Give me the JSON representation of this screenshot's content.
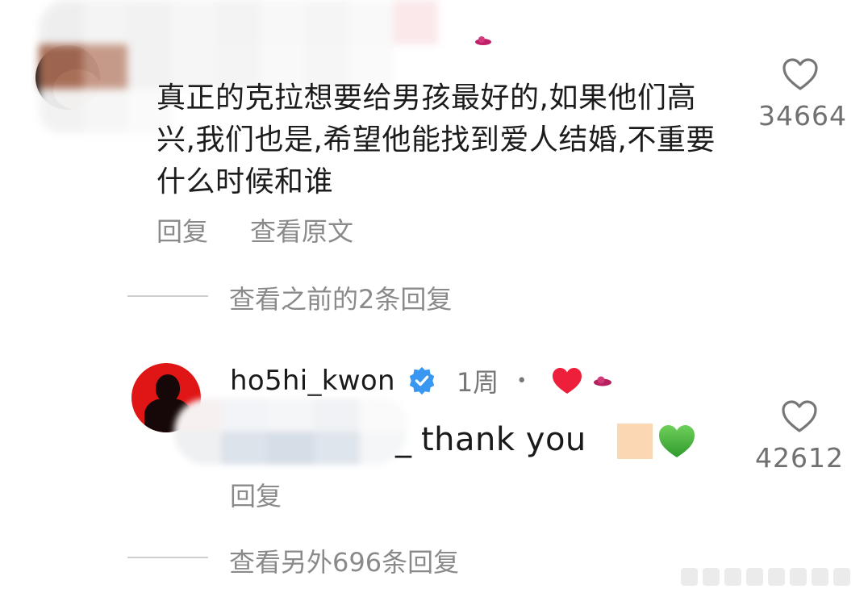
{
  "comment": {
    "text": "真正的克拉想要给男孩最好的,如果他们高兴,我们也是,希望他能找到爱人结婚,不重要什么时候和谁",
    "like_count": "34664",
    "actions": {
      "reply_label": "回复",
      "view_original_label": "查看原文"
    }
  },
  "view_previous_replies": "查看之前的2条回复",
  "reply": {
    "username": "ho5hi_kwon",
    "time": "1周",
    "separator": "•",
    "mention_suffix": "_",
    "text": "thank you",
    "like_count": "42612",
    "reply_label": "回复"
  },
  "view_more_replies": "查看另外696条回复",
  "colors": {
    "verified_badge": "#3897f0",
    "heart_red": "#ed1f3a",
    "green_heart": "#4caf3f",
    "muted_text": "#8a8a8a"
  },
  "icons": {
    "like": "heart-outline-icon",
    "verified": "verified-badge-icon",
    "creator_liked": "red-heart-icon",
    "emoji": "green-heart-emoji"
  }
}
